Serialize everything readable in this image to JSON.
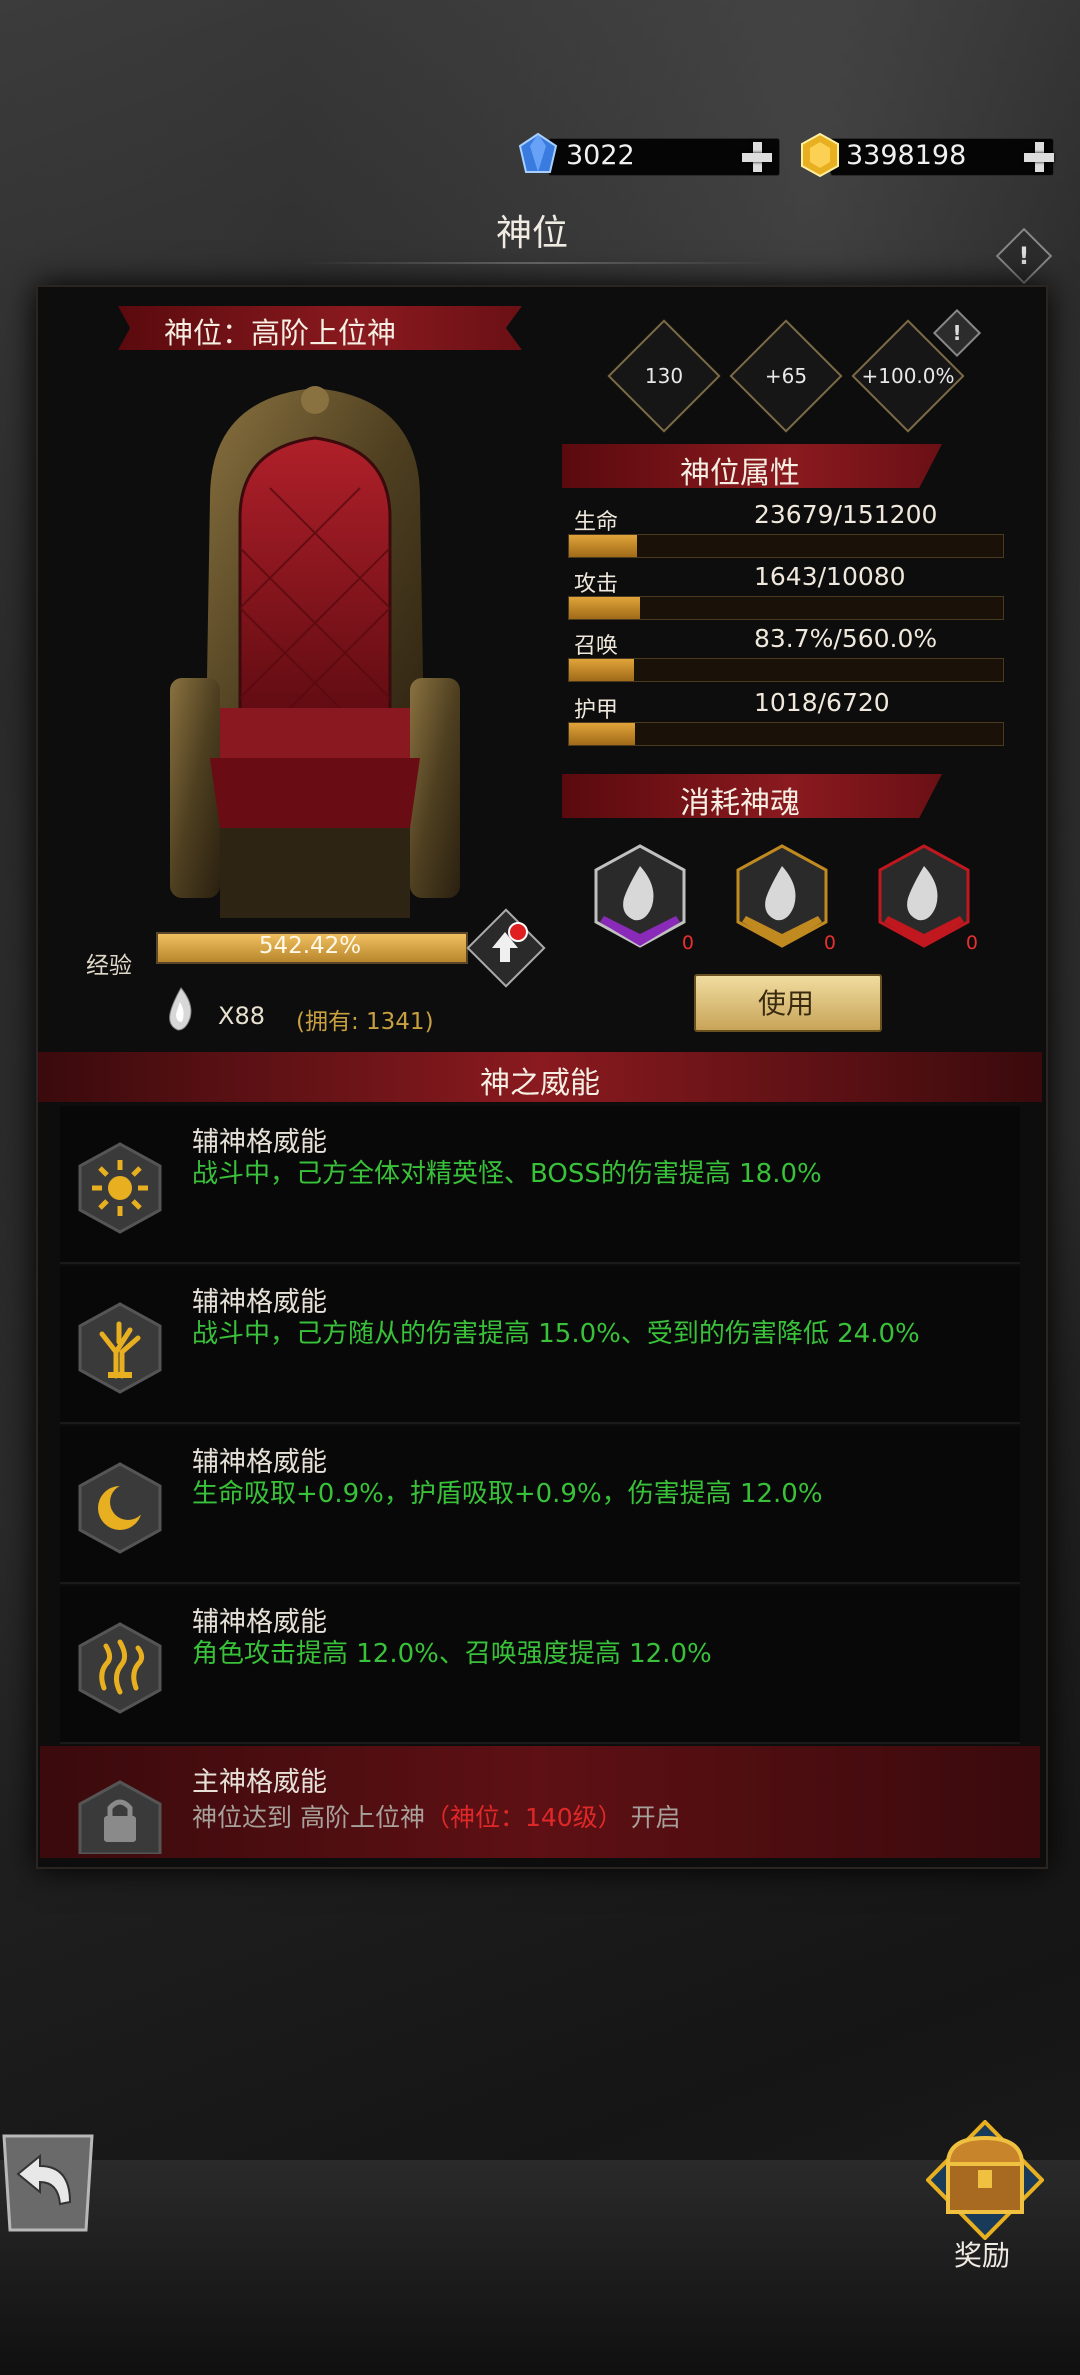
{
  "currencies": {
    "diamond": "3022",
    "gold": "3398198"
  },
  "title": "神位",
  "rank_ribbon": "神位：高阶上位神",
  "badges": [
    "130",
    "+65",
    "+100.0%"
  ],
  "attributes": {
    "header": "神位属性",
    "items": [
      {
        "label": "生命",
        "value": "23679/151200",
        "fill": 0.157
      },
      {
        "label": "攻击",
        "value": "1643/10080",
        "fill": 0.163
      },
      {
        "label": "召唤",
        "value": "83.7%/560.0%",
        "fill": 0.149
      },
      {
        "label": "护甲",
        "value": "1018/6720",
        "fill": 0.151
      }
    ]
  },
  "consume": {
    "header": "消耗神魂",
    "souls": [
      {
        "count": "0",
        "color": "#8a2ab8"
      },
      {
        "count": "0",
        "color": "#c08a20"
      },
      {
        "count": "0",
        "color": "#c0181e"
      }
    ],
    "use_button": "使用"
  },
  "exp": {
    "label": "经验",
    "percent_text": "542.42%",
    "fill": 1.0,
    "soul_count": "X88",
    "owned": "(拥有: 1341)"
  },
  "powers": {
    "header": "神之威能",
    "items": [
      {
        "title": "辅神格威能",
        "desc": "战斗中，己方全体对精英怪、BOSS的伤害提高 18.0%",
        "icon": "sun-icon"
      },
      {
        "title": "辅神格威能",
        "desc": "战斗中，己方随从的伤害提高 15.0%、受到的伤害降低 24.0%",
        "icon": "tree-icon"
      },
      {
        "title": "辅神格威能",
        "desc": "生命吸取+0.9%，护盾吸取+0.9%，伤害提高 12.0%",
        "icon": "moon-icon"
      },
      {
        "title": "辅神格威能",
        "desc": "角色攻击提高 12.0%、召唤强度提高 12.0%",
        "icon": "flame-icon"
      }
    ],
    "main": {
      "title": "主神格威能",
      "desc_prefix": "神位达到 高阶上位神",
      "desc_req": "（神位：140级）",
      "desc_suffix": " 开启",
      "icon": "lock-icon"
    }
  },
  "reward_label": "奖励",
  "colors": {
    "accent_red": "#8a1a1f",
    "green_text": "#39c13a",
    "gold": "#e0a43a"
  }
}
